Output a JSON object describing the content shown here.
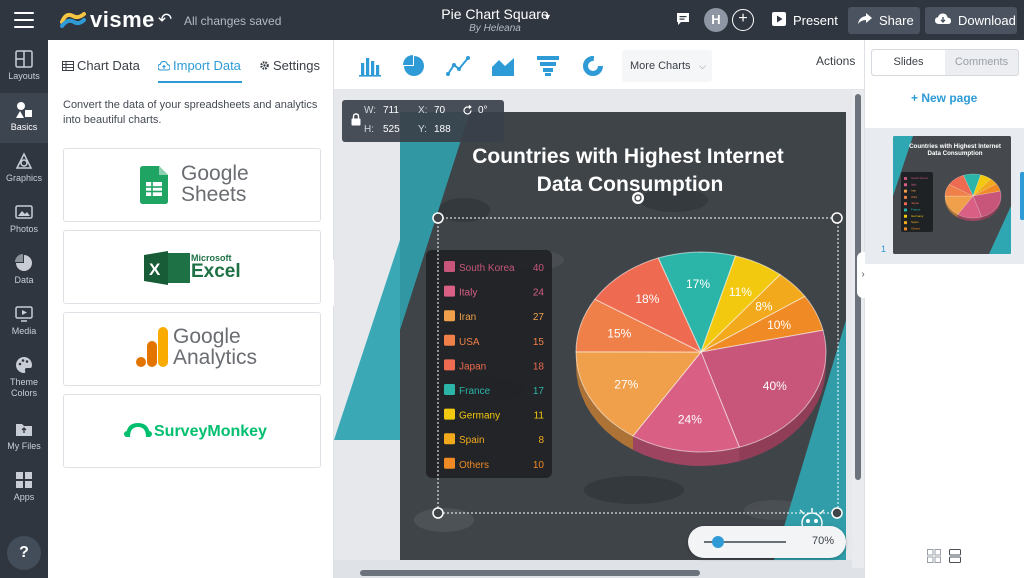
{
  "topbar": {
    "logo_text": "visme",
    "save_status": "All changes saved",
    "doc_title": "Pie Chart Square",
    "doc_byline": "By Heleana",
    "avatar_initial": "H",
    "present_label": "Present",
    "share_label": "Share",
    "download_label": "Download"
  },
  "sidebar": {
    "items": [
      {
        "label": "Layouts",
        "icon": "layout-icon"
      },
      {
        "label": "Basics",
        "icon": "basics-icon"
      },
      {
        "label": "Graphics",
        "icon": "graphics-icon"
      },
      {
        "label": "Photos",
        "icon": "photos-icon"
      },
      {
        "label": "Data",
        "icon": "pie-chart-icon"
      },
      {
        "label": "Media",
        "icon": "media-icon"
      },
      {
        "label": "Theme Colors",
        "icon": "palette-icon"
      },
      {
        "label": "My Files",
        "icon": "files-icon"
      },
      {
        "label": "Apps",
        "icon": "apps-icon"
      }
    ],
    "help_label": "?"
  },
  "panel": {
    "tabs": [
      "Chart Data",
      "Import Data",
      "Settings"
    ],
    "active_tab": "Import Data",
    "description": "Convert the data of your spreadsheets and analytics into beautiful charts.",
    "sources": {
      "sheets_line1": "Google",
      "sheets_line2": "Sheets",
      "excel_small": "Microsoft",
      "excel_big": "Excel",
      "analytics_line1": "Google",
      "analytics_line2": "Analytics",
      "surveymonkey": "SurveyMonkey"
    }
  },
  "toolbar": {
    "chart_icons": [
      "bar-chart-icon",
      "pie-chart-icon",
      "line-chart-icon",
      "area-chart-icon",
      "funnel-chart-icon",
      "donut-chart-icon"
    ],
    "more_charts_label": "More Charts",
    "actions_label": "Actions"
  },
  "canvas": {
    "dims": {
      "w_label": "W:",
      "w": "711",
      "x_label": "X:",
      "x": "70",
      "rot": "0°",
      "h_label": "H:",
      "h": "525",
      "y_label": "Y:",
      "y": "188"
    },
    "zoom_label": "70%",
    "zoom_level": 0.7
  },
  "chart_data": {
    "type": "pie",
    "title": "Countries with Highest Internet Data Consumption",
    "categories": [
      "South Korea",
      "Italy",
      "Iran",
      "USA",
      "Japan",
      "France",
      "Germany",
      "Spain",
      "Others"
    ],
    "values": [
      40,
      24,
      27,
      15,
      18,
      17,
      11,
      8,
      10
    ],
    "slice_labels": [
      "40%",
      "24%",
      "27%",
      "15%",
      "18%",
      "17%",
      "11%",
      "8%",
      "10%"
    ],
    "colors": [
      "#c8567a",
      "#d95f85",
      "#f0a04b",
      "#f08049",
      "#ee6a50",
      "#2bb5a8",
      "#f2c90f",
      "#f2a91c",
      "#f08a24"
    ],
    "legend_placement": "left"
  },
  "rightpanel": {
    "tabs": [
      "Slides",
      "Comments"
    ],
    "new_page_label": "+ New page",
    "slide_number": "1",
    "thumb_title": "Countries with Highest Internet Data Consumption"
  }
}
